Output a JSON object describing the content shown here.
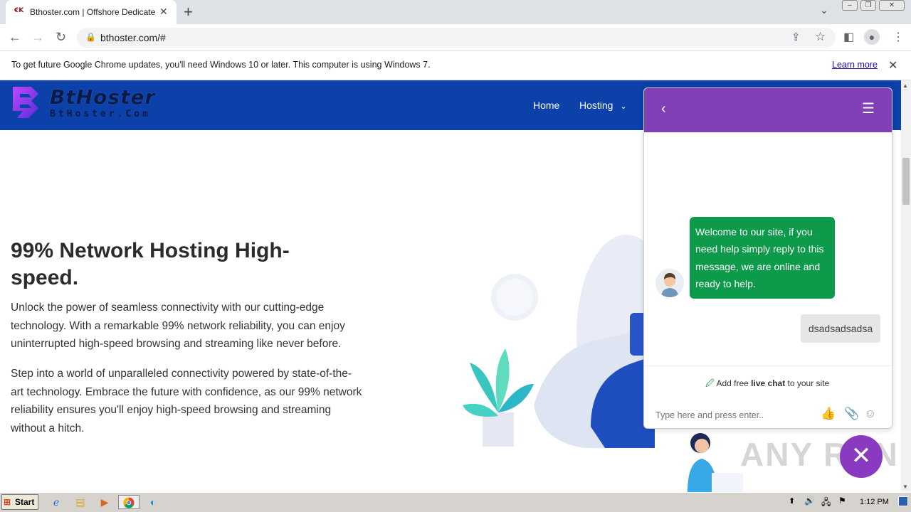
{
  "browser": {
    "tab_title": "Bthoster.com | Offshore Dedicated S",
    "tab_favicon": "€K",
    "url": "bthoster.com/#",
    "info_message": "To get future Google Chrome updates, you'll need Windows 10 or later. This computer is using Windows 7.",
    "learn_more": "Learn more"
  },
  "site": {
    "brand": "BtHoster",
    "brand_sub": "BtHoster.Com",
    "nav": {
      "home": "Home",
      "hosting": "Hosting"
    },
    "headline": "99% Network Hosting High-speed.",
    "para1": "Unlock the power of seamless connectivity with our cutting-edge technology. With a remarkable 99% network reliability, you can enjoy uninterrupted high-speed browsing and streaming like never before.",
    "para2": "Step into a world of unparalleled connectivity powered by state-of-the-art technology. Embrace the future with confidence, as our 99% network reliability ensures you'll enjoy high-speed browsing and streaming without a hitch."
  },
  "chat": {
    "welcome": "Welcome to our site, if you need help simply reply to this message, we are online and ready to help.",
    "user_message": "dsadsadsadsa",
    "promo_prefix": "Add free ",
    "promo_bold": "live chat",
    "promo_suffix": " to your site",
    "input_placeholder": "Type here and press enter..",
    "header_color": "#8240b7",
    "bubble_color": "#0e9a4b"
  },
  "watermark": "ANY RUN",
  "taskbar": {
    "start": "Start",
    "clock": "1:12 PM"
  },
  "colors": {
    "site_header": "#0b41a8"
  }
}
